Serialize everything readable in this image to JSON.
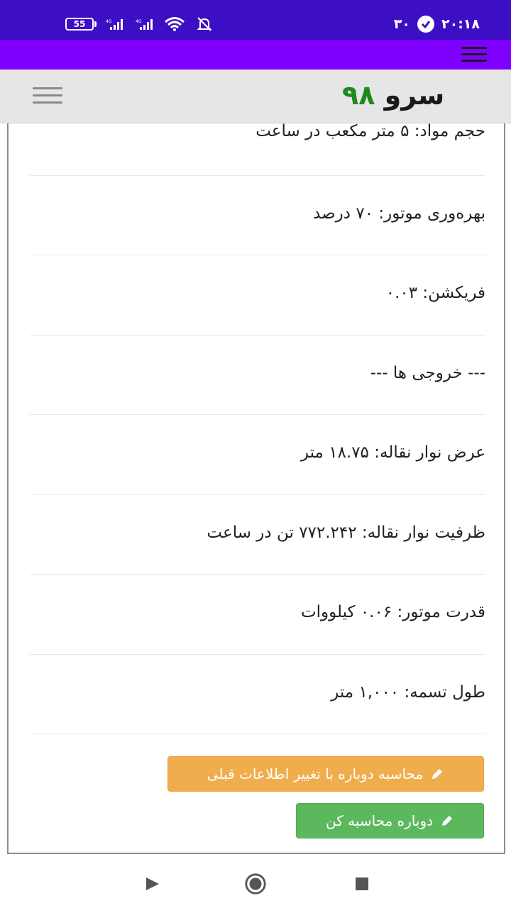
{
  "status_bar": {
    "battery": "55",
    "signal1_tag": "4G",
    "signal2_tag": "4G",
    "time": "۲۰:۱۸",
    "notification_count": "۳۰"
  },
  "header": {
    "logo_word": "سرو",
    "logo_number": "۹۸"
  },
  "rows": [
    {
      "label": "حجم مواد: ۵ متر مکعب در ساعت"
    },
    {
      "label": "بهره‌وری موتور: ۷۰ درصد"
    },
    {
      "label": "فریکشن: ۰.۰۳"
    },
    {
      "label": "--- خروجی ها ---"
    },
    {
      "label": "عرض نوار نقاله: ۱۸.۷۵ متر"
    },
    {
      "label": "ظرفیت نوار نقاله: ۷۷۲.۲۴۲ تن در ساعت"
    },
    {
      "label": "قدرت موتور: ۰.۰۶ کیلووات"
    },
    {
      "label": "طول تسمه: ۱,۰۰۰ متر"
    }
  ],
  "buttons": {
    "recalc_with_previous": "محاسبه دوباره با تغییر اطلاعات قبلی",
    "recalc": "دوباره محاسبه کن"
  },
  "colors": {
    "status_bar": "#3d0fc4",
    "app_bar": "#7f00ff",
    "header_bg": "#e6e6e6",
    "logo_green": "#1e8a1e",
    "button_orange": "#f0ad4e",
    "button_green": "#5cb85c"
  }
}
